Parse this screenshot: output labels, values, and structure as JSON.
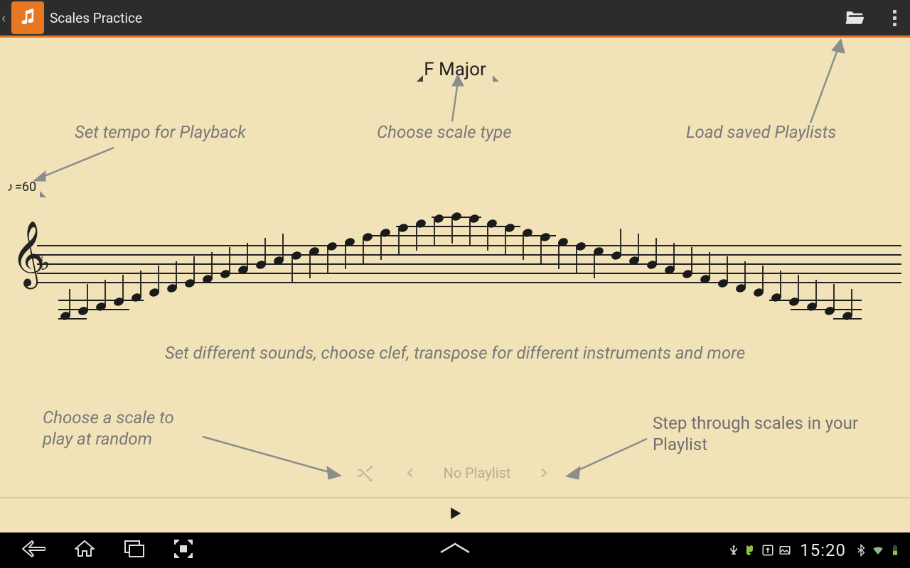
{
  "header": {
    "title": "Scales Practice"
  },
  "scale": {
    "name": "F Major",
    "tempo_label": "=60"
  },
  "annotations": {
    "tempo": "Set tempo for Playback",
    "scale_type": "Choose scale type",
    "playlists": "Load saved Playlists",
    "settings": "Set different sounds, choose clef, transpose for different instruments and more",
    "random": "Choose a scale to\nplay at random",
    "step": "Step through scales in your\nPlaylist"
  },
  "playlist_bar": {
    "label": "No Playlist"
  },
  "status_bar": {
    "time": "15:20"
  }
}
